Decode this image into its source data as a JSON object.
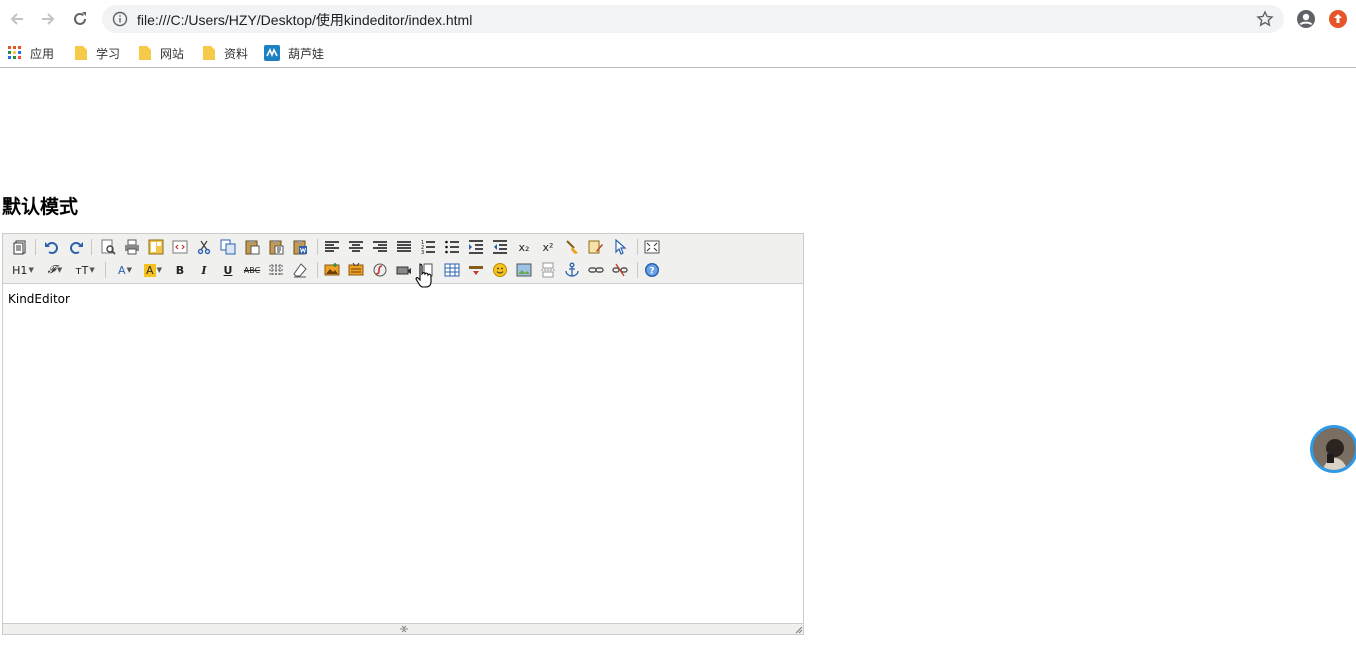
{
  "browser": {
    "url": "file:///C:/Users/HZY/Desktop/使用kindeditor/index.html",
    "nav": {
      "back": "back-arrow-icon",
      "forward": "forward-arrow-icon",
      "reload": "reload-icon"
    },
    "bookmarks": [
      {
        "label": "应用",
        "icon": "apps-grid-icon"
      },
      {
        "label": "学习",
        "icon": "folder-icon"
      },
      {
        "label": "网站",
        "icon": "folder-icon"
      },
      {
        "label": "资料",
        "icon": "folder-icon"
      },
      {
        "label": "葫芦娃",
        "icon": "site-logo-icon"
      }
    ],
    "colors": {
      "folder": "#f7c948",
      "accent_update": "#e8542a",
      "omnibox_bg": "#f1f3f4"
    }
  },
  "page": {
    "heading": "默认模式"
  },
  "editor": {
    "toolbar": {
      "heading_label": "H1",
      "fontname_label": "𝓕",
      "fontsize_label": "тT",
      "forecolor_label": "A",
      "hilitecolor_label": "A",
      "bold_label": "B",
      "italic_label": "I",
      "underline_label": "U",
      "strike_label": "ABC",
      "subscript_label": "x₂",
      "superscript_label": "x²"
    },
    "content": "KindEditor",
    "colors": {
      "toolbar_bg": "#f0f0ee",
      "border": "#cccccc",
      "highlight": "#f6c21e"
    }
  }
}
